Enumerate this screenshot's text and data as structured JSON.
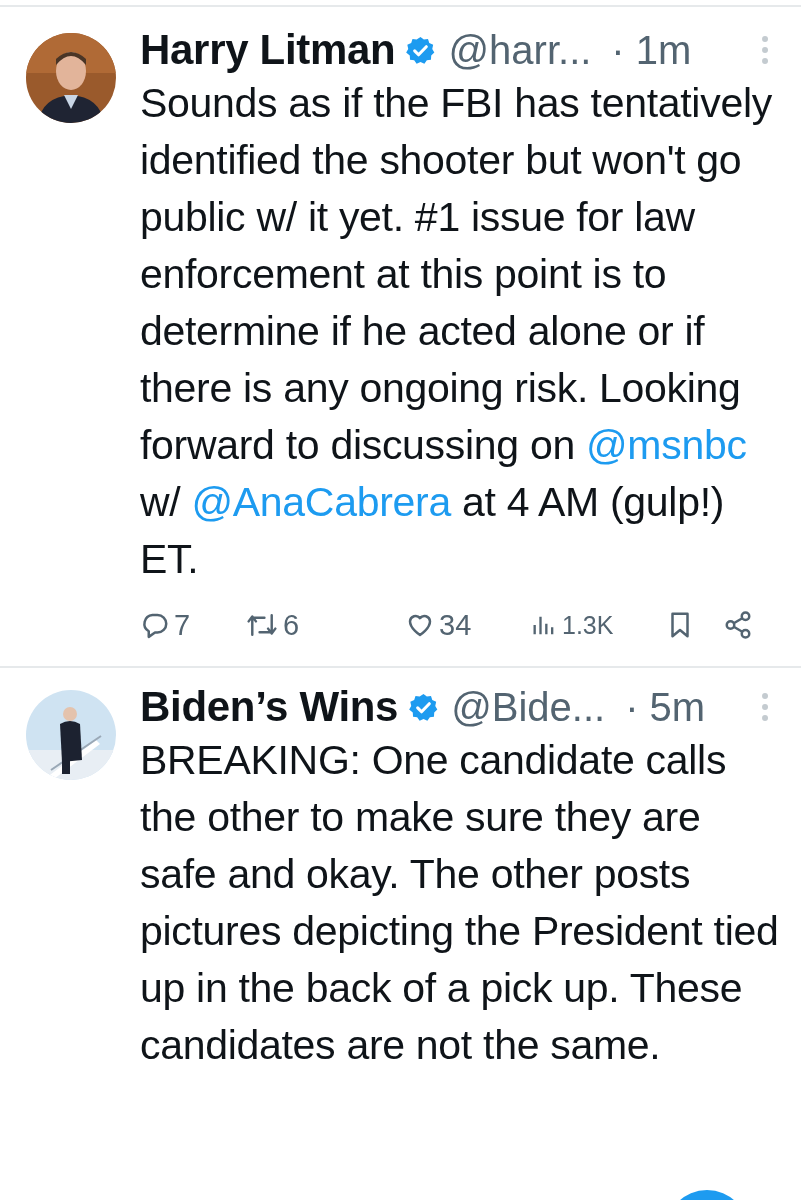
{
  "tweets": [
    {
      "name": "Harry Litman",
      "verified": true,
      "handle": "@harr...",
      "time": "· 1m",
      "avatar": {
        "kind": "picture"
      },
      "text": [
        {
          "kind": "plain",
          "text": "Sounds as if the FBI has tentatively identified the shooter but won't go public w/ it yet.  #1 issue for law enforcement at this point is to determine if he acted alone or if there is any ongoing risk. Looking forward to discussing on "
        },
        {
          "kind": "mention",
          "text": "@msnbc"
        },
        {
          "kind": "plain",
          "text": " w/ "
        },
        {
          "kind": "mention",
          "text": "@AnaCabrera"
        },
        {
          "kind": "plain",
          "text": " at 4 AM (gulp!) ET."
        }
      ],
      "actions": {
        "replies": "7",
        "reposts": "6",
        "likes": "34",
        "views": "1.3K"
      }
    },
    {
      "name": "Biden’s Wins",
      "verified": true,
      "handle": "@Bide...",
      "time": "· 5m",
      "avatar": {
        "kind": "picture"
      },
      "text": [
        {
          "kind": "plain",
          "text": "BREAKING: One candidate calls the other to make sure they are safe and okay. The other posts pictures depicting the President tied up in the back of a pick up. These candidates are not the same."
        }
      ]
    }
  ]
}
